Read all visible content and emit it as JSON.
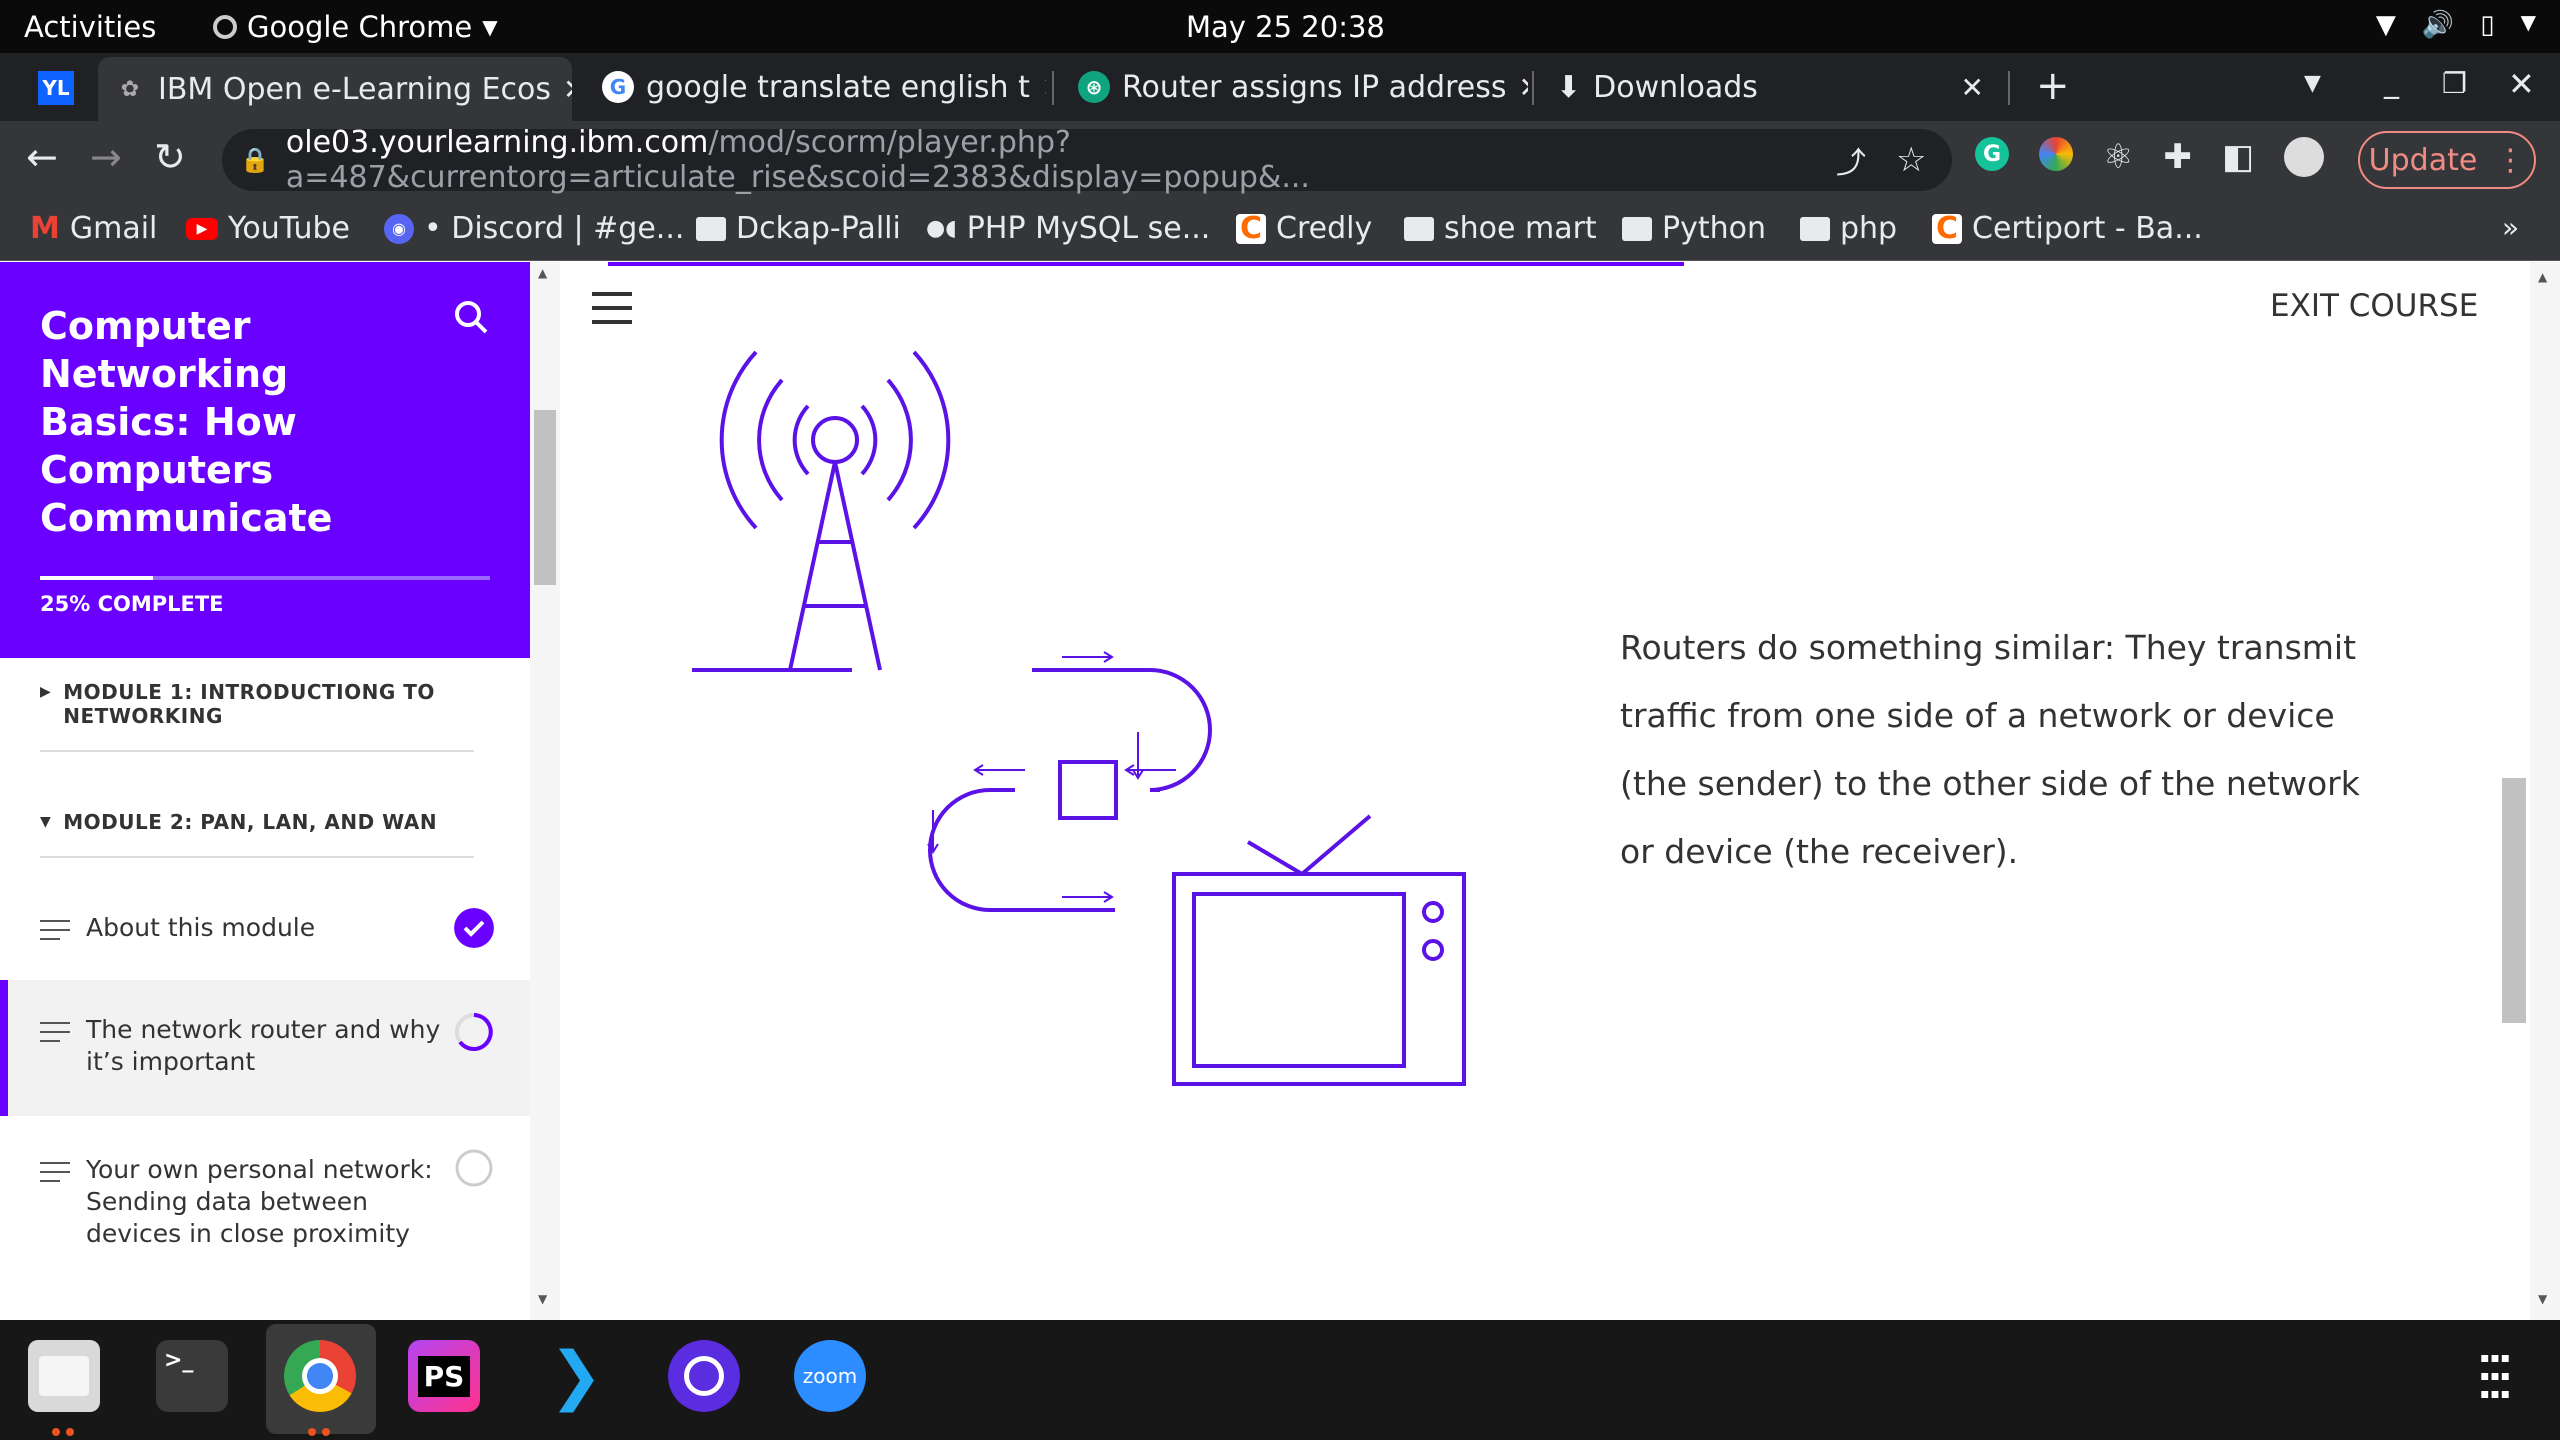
{
  "os": {
    "activities": "Activities",
    "app_name": "Google Chrome",
    "datetime": "May 25  20:38"
  },
  "tabs": [
    {
      "label": "IBM Open e-Learning Ecos",
      "active": true
    },
    {
      "label": "google translate english t",
      "active": false
    },
    {
      "label": "Router assigns IP address",
      "active": false
    },
    {
      "label": "Downloads",
      "active": false
    }
  ],
  "address": {
    "host": "ole03.yourlearning.ibm.com",
    "path": "/mod/scorm/player.php?a=487&currentorg=articulate_rise&scoid=2383&display=popup&..."
  },
  "update_label": "Update",
  "bookmarks": [
    {
      "label": "Gmail",
      "icon": "gmail-icon"
    },
    {
      "label": "YouTube",
      "icon": "youtube-icon"
    },
    {
      "label": "• Discord | #ge...",
      "icon": "discord-icon"
    },
    {
      "label": "Dckap-Palli",
      "icon": "folder-icon"
    },
    {
      "label": "PHP MySQL se...",
      "icon": "medium-icon"
    },
    {
      "label": "Credly",
      "icon": "credly-icon"
    },
    {
      "label": "shoe mart",
      "icon": "folder-icon"
    },
    {
      "label": "Python",
      "icon": "folder-icon"
    },
    {
      "label": "php",
      "icon": "folder-icon"
    },
    {
      "label": "Certiport - Ba...",
      "icon": "credly-icon"
    }
  ],
  "course": {
    "title": "Computer Networking Basics: How Computers Communicate",
    "progress_label": "25% COMPLETE",
    "progress_percent": 25,
    "modules": [
      {
        "label": "MODULE 1: INTRODUCTIONG TO NETWORKING",
        "expanded": false
      },
      {
        "label": "MODULE 2: PAN, LAN, AND WAN",
        "expanded": true
      }
    ],
    "lessons": [
      {
        "label": "About this module",
        "status": "complete"
      },
      {
        "label": "The network router and why it’s important",
        "status": "in-progress"
      },
      {
        "label": "Your own personal network: Sending data between devices in close proximity",
        "status": "not-started"
      }
    ]
  },
  "content": {
    "exit_label": "EXIT COURSE",
    "paragraph": "Routers do something similar: They transmit traffic from one side of a network or device (the sender) to the other side of the network or device (the receiver)."
  },
  "colors": {
    "accent": "#6a00ff",
    "illustration": "#5a12e6"
  },
  "dock": [
    {
      "name": "files-icon"
    },
    {
      "name": "terminal-icon"
    },
    {
      "name": "chrome-icon"
    },
    {
      "name": "phpstorm-icon"
    },
    {
      "name": "vscode-icon"
    },
    {
      "name": "app-icon"
    },
    {
      "name": "zoom-icon",
      "label": "zoom"
    },
    {
      "name": "app-grid-icon"
    }
  ]
}
